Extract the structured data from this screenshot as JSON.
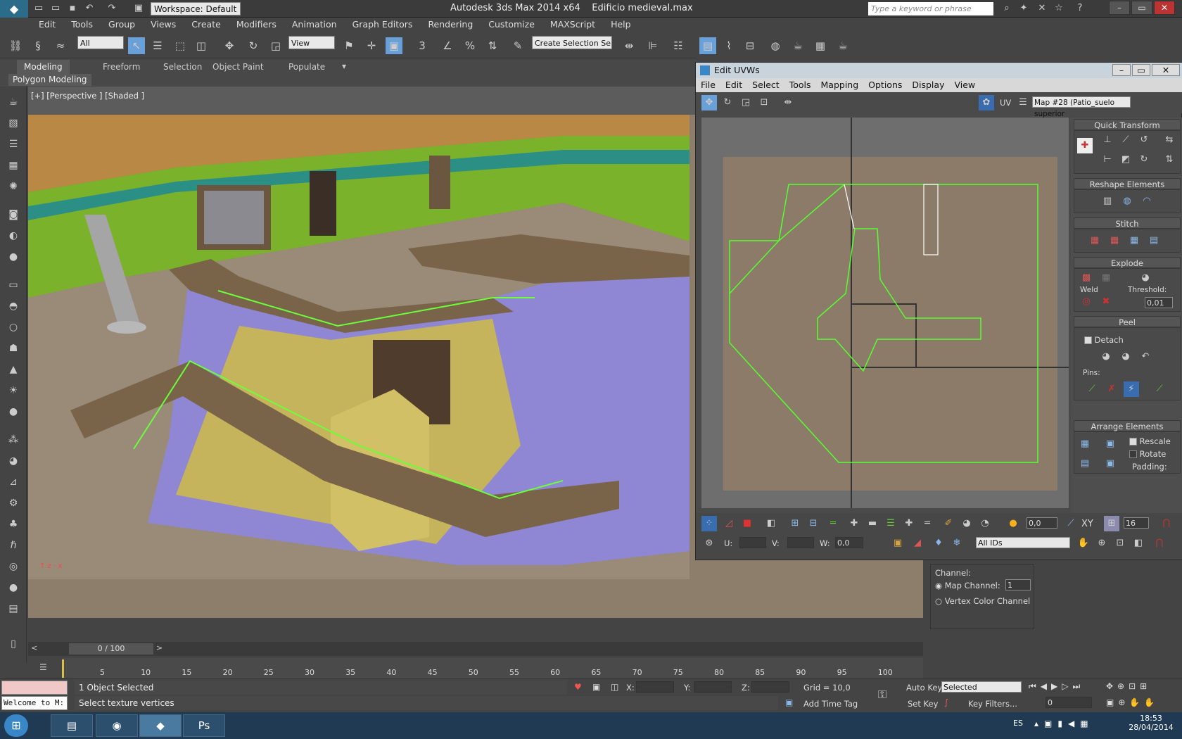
{
  "window": {
    "title": "Autodesk 3ds Max  2014 x64",
    "file": "Edificio medieval.max",
    "workspace": "Workspace: Default",
    "search_placeholder": "Type a keyword or phrase"
  },
  "menu": [
    "Edit",
    "Tools",
    "Group",
    "Views",
    "Create",
    "Modifiers",
    "Animation",
    "Graph Editors",
    "Rendering",
    "Customize",
    "MAXScript",
    "Help"
  ],
  "toolbar": {
    "filter": "All",
    "refcoord": "View",
    "selection_set": "Create Selection Se",
    "snap3": "3",
    "snap_pct": "%"
  },
  "ribbon": {
    "tabs": [
      "Modeling",
      "Freeform",
      "Selection",
      "Object Paint",
      "Populate"
    ],
    "panel_label": "Polygon Modeling"
  },
  "viewport": {
    "label": "[+] [Perspective ] [Shaded ]"
  },
  "timeline": {
    "frame": "0 / 100",
    "ticks": [
      "5",
      "10",
      "15",
      "20",
      "25",
      "30",
      "35",
      "40",
      "45",
      "50",
      "55",
      "60",
      "65",
      "70",
      "75",
      "80",
      "85",
      "90",
      "95",
      "100"
    ]
  },
  "status": {
    "selected": "1 Object Selected",
    "prompt": "Select texture vertices",
    "maxscript": "Welcome to M:",
    "x_label": "X:",
    "y_label": "Y:",
    "z_label": "Z:",
    "grid": "Grid = 10,0",
    "autokey": "Auto Key",
    "setkey": "Set Key",
    "selected_mode": "Selected",
    "key_filters": "Key Filters...",
    "add_time_tag": "Add Time Tag",
    "frame_field": "0"
  },
  "tray": {
    "lang": "ES",
    "time": "18:53",
    "date": "28/04/2014"
  },
  "uvw": {
    "title": "Edit UVWs",
    "menu": [
      "File",
      "Edit",
      "Select",
      "Tools",
      "Mapping",
      "Options",
      "Display",
      "View"
    ],
    "uv_label": "UV",
    "map": "Map #28 (Patio_suelo superior",
    "panel": {
      "quick_transform": "Quick Transform",
      "reshape": "Reshape Elements",
      "stitch": "Stitch",
      "explode": "Explode",
      "weld": "Weld",
      "threshold_label": "Threshold:",
      "threshold": "0,01",
      "peel": "Peel",
      "detach": "Detach",
      "pins": "Pins:",
      "arrange": "Arrange Elements",
      "rescale": "Rescale",
      "rotate": "Rotate",
      "padding": "Padding:"
    },
    "bottom": {
      "value1": "0,0",
      "xy": "XY",
      "num": "16",
      "u": "U:",
      "v": "V:",
      "w": "W:",
      "w_value": "0,0",
      "ids": "All IDs"
    }
  },
  "channel": {
    "title": "Channel:",
    "map_channel": "Map Channel:",
    "map_channel_value": "1",
    "vertex_color": "Vertex Color Channel"
  }
}
